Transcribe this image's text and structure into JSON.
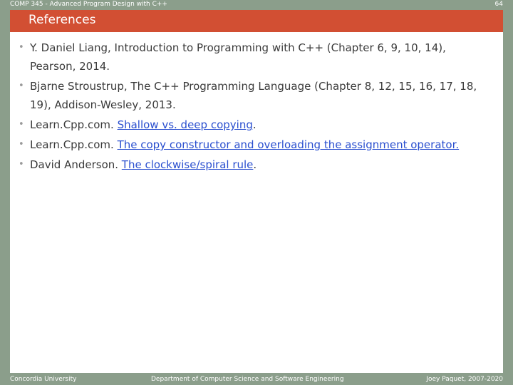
{
  "header": {
    "course": "COMP 345 - Advanced Program Design with C++",
    "page_number": "64"
  },
  "title": "References",
  "references": [
    {
      "text": "Y. Daniel Liang, Introduction to Programming with C++ (Chapter 6, 9, 10, 14), Pearson, 2014."
    },
    {
      "text": "Bjarne Stroustrup, The C++ Programming Language (Chapter 8, 12, 15, 16, 17, 18, 19), Addison-Wesley, 2013."
    },
    {
      "prefix": "Learn.Cpp.com. ",
      "link": "Shallow vs. deep copying",
      "suffix": "."
    },
    {
      "prefix": "Learn.Cpp.com. ",
      "link": "The copy constructor and overloading the assignment operator.",
      "suffix": ""
    },
    {
      "prefix": "David Anderson. ",
      "link": "The clockwise/spiral rule",
      "suffix": "."
    }
  ],
  "bullet_char": "•",
  "footer": {
    "left": "Concordia University",
    "center": "Department of Computer Science and Software Engineering",
    "right": "Joey Paquet, 2007-2020"
  },
  "colors": {
    "background": "#8b9e8b",
    "title_bar": "#d24f33",
    "link": "#2a4fcf"
  }
}
